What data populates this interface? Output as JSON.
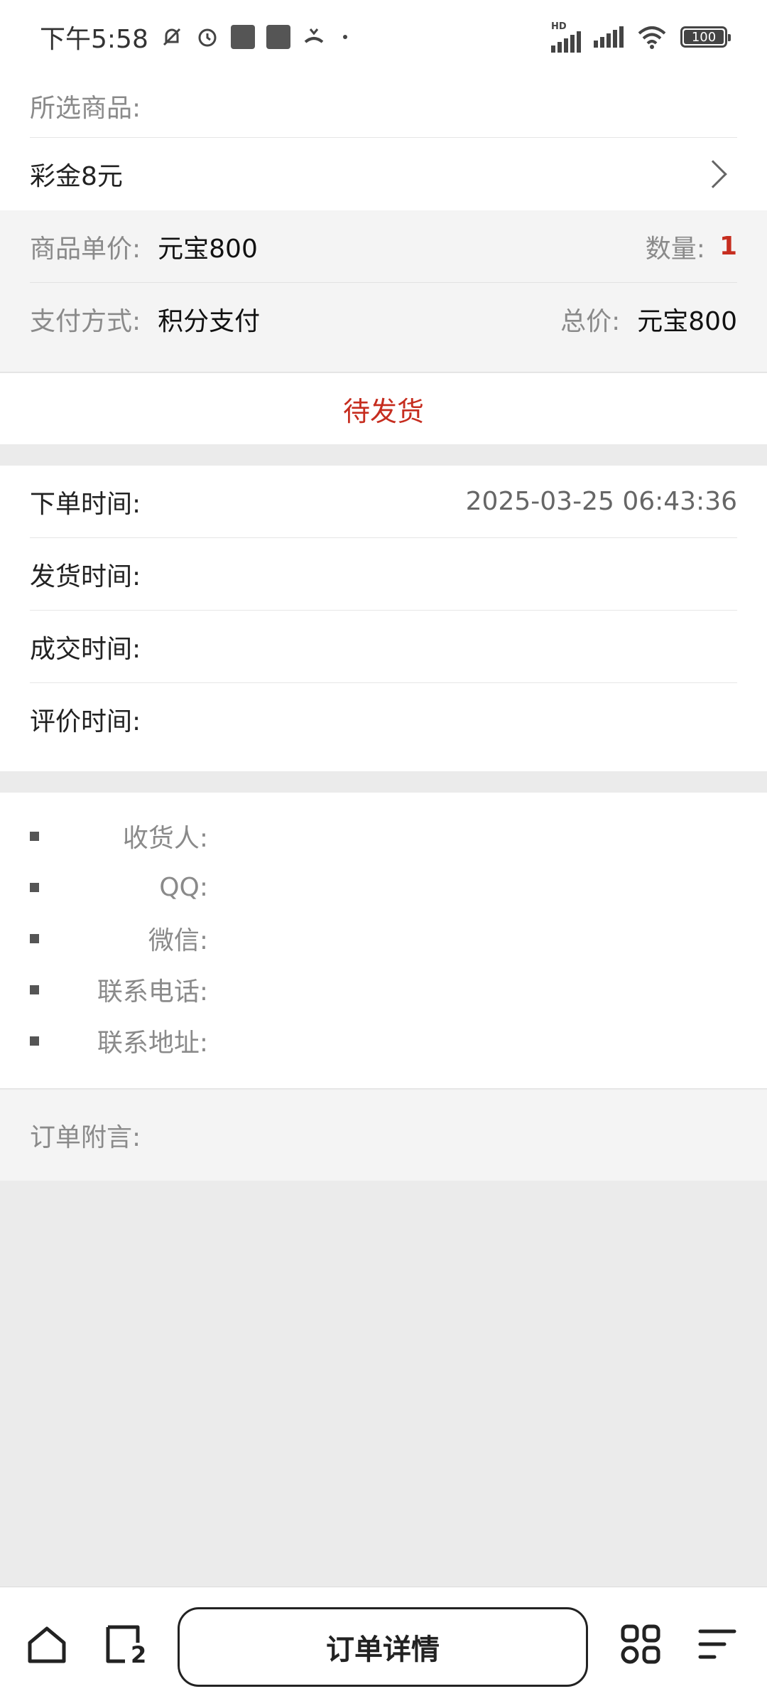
{
  "status_bar": {
    "time": "下午5:58",
    "network_badge": "HD",
    "battery": "100",
    "icons": [
      "bell-muted-icon",
      "alarm-icon",
      "app-icon",
      "app-icon",
      "call-icon",
      "signal-icon",
      "wifi-icon",
      "battery-icon"
    ]
  },
  "product": {
    "section_label": "所选商品:",
    "name": "彩金8元"
  },
  "price": {
    "unit_price_label": "商品单价:",
    "unit_price_value": "元宝800",
    "quantity_label": "数量:",
    "quantity_value": "1",
    "payment_label": "支付方式:",
    "payment_value": "积分支付",
    "total_label": "总价:",
    "total_value": "元宝800"
  },
  "order_status": "待发货",
  "times": [
    {
      "label": "下单时间:",
      "value": "2025-03-25 06:43:36"
    },
    {
      "label": "发货时间:",
      "value": ""
    },
    {
      "label": "成交时间:",
      "value": ""
    },
    {
      "label": "评价时间:",
      "value": ""
    }
  ],
  "contact": [
    {
      "label": "收货人:"
    },
    {
      "label": "QQ:"
    },
    {
      "label": "微信:"
    },
    {
      "label": "联系电话:"
    },
    {
      "label": "联系地址:"
    }
  ],
  "note_label": "订单附言:",
  "bottom_nav": {
    "center_label": "订单详情",
    "tab_count": "2"
  },
  "colors": {
    "accent_red": "#c62d1f",
    "background": "#ebebeb"
  }
}
